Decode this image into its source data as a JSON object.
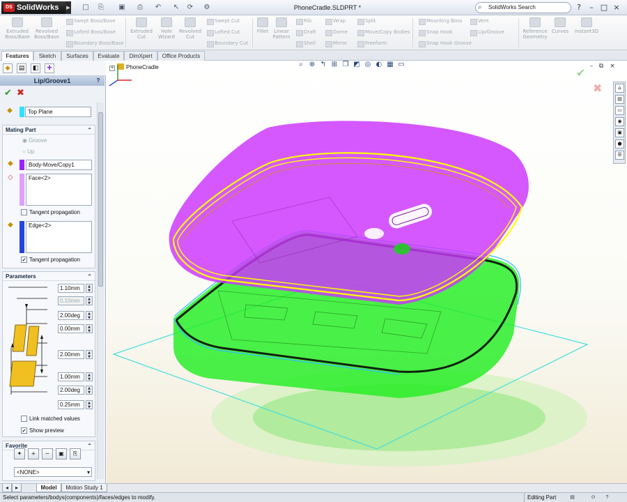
{
  "app": {
    "logo_text": "SolidWorks",
    "logo_badge": "DS",
    "document_title": "PhoneCradle.SLDPRT *",
    "search_placeholder": "SolidWorks Search"
  },
  "window_buttons": [
    "?",
    "–",
    "□",
    "×"
  ],
  "ribbon": {
    "big_tools": [
      {
        "label": "Extruded Boss/Base",
        "icon": "extruded-boss-icon"
      },
      {
        "label": "Revolved Boss/Base",
        "icon": "revolved-boss-icon"
      },
      {
        "label": "Extruded Cut",
        "icon": "extruded-cut-icon"
      },
      {
        "label": "Hole Wizard",
        "icon": "hole-wizard-icon"
      },
      {
        "label": "Revolved Cut",
        "icon": "revolved-cut-icon"
      },
      {
        "label": "Fillet",
        "icon": "fillet-icon"
      },
      {
        "label": "Linear Pattern",
        "icon": "linear-pattern-icon"
      },
      {
        "label": "Reference Geometry",
        "icon": "reference-geometry-icon"
      },
      {
        "label": "Curves",
        "icon": "curves-icon"
      },
      {
        "label": "Instant3D",
        "icon": "instant3d-icon"
      }
    ],
    "small_tools": [
      "Swept Boss/Base",
      "Lofted Boss/Base",
      "Boundary Boss/Base",
      "Swept Cut",
      "Lofted Cut",
      "Boundary Cut",
      "Rib",
      "Draft",
      "Shell",
      "Wrap",
      "Dome",
      "Mirror",
      "Split",
      "Move/Copy Bodies",
      "Freeform",
      "Mounting Boss",
      "Snap Hook",
      "Snap Hook Groove",
      "Vent",
      "Lip/Groove"
    ]
  },
  "tabs": [
    "Features",
    "Sketch",
    "Surfaces",
    "Evaluate",
    "DimXpert",
    "Office Products"
  ],
  "property_manager": {
    "title": "Lip/Groove1",
    "help": "?",
    "plane_field": "Top Plane",
    "mating_part": {
      "header": "Mating Part",
      "radio_groove": "Groove",
      "radio_up": "Up",
      "body_field": "Body-Move/Copy1",
      "face_list": "Face<2>",
      "tangent_1": "Tangent propagation",
      "edge_list": "Edge<2>",
      "tangent_2": "Tangent propagation"
    },
    "parameters": {
      "header": "Parameters",
      "values": [
        "1.10mm",
        "0.10mm",
        "2.00deg",
        "0.00mm",
        "2.00mm",
        "1.00mm",
        "2.00deg",
        "0.25mm"
      ],
      "link_matched": "Link matched values",
      "show_preview": "Show preview"
    },
    "favorite": {
      "header": "Favorite",
      "select_value": "<NONE>"
    }
  },
  "viewport": {
    "tree_root": "PhoneCradle"
  },
  "bottom_tabs": [
    "Model",
    "Motion Study 1"
  ],
  "status": {
    "message": "Select parameters/bodys(components)/faces/edges to modify.",
    "mode": "Editing Part"
  },
  "colors": {
    "lip_body": "#cc33ff",
    "groove_body": "#22ee22",
    "selection": "#ffff00",
    "plane_outline": "#44dddd",
    "part_icon": "#e0b020"
  }
}
